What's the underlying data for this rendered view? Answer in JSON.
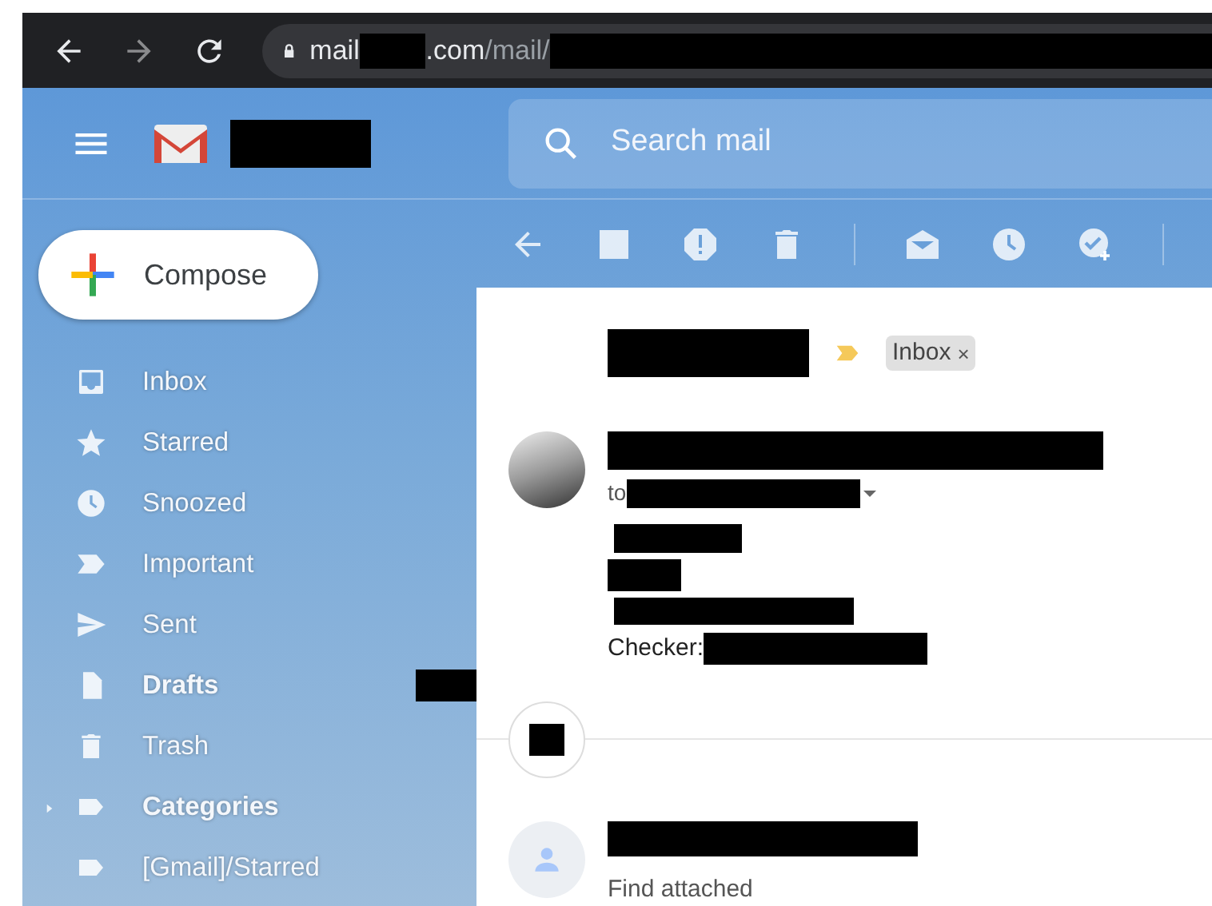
{
  "browser": {
    "url": {
      "host_start": "mail",
      "host_end": ".com",
      "path": "/mail/"
    }
  },
  "header": {
    "search": {
      "placeholder": "Search mail"
    }
  },
  "compose": {
    "label": "Compose"
  },
  "sidebar": {
    "items": [
      {
        "label": "Inbox",
        "kind": "inbox",
        "unread": false,
        "expandable": false
      },
      {
        "label": "Starred",
        "kind": "star",
        "unread": false,
        "expandable": false
      },
      {
        "label": "Snoozed",
        "kind": "clock",
        "unread": false,
        "expandable": false
      },
      {
        "label": "Important",
        "kind": "important",
        "unread": false,
        "expandable": false
      },
      {
        "label": "Sent",
        "kind": "send",
        "unread": false,
        "expandable": false
      },
      {
        "label": "Drafts",
        "kind": "file",
        "unread": true,
        "expandable": false
      },
      {
        "label": "Trash",
        "kind": "trash",
        "unread": false,
        "expandable": false
      },
      {
        "label": "Categories",
        "kind": "label",
        "unread": true,
        "expandable": true
      },
      {
        "label": "[Gmail]/Starred",
        "kind": "label",
        "unread": false,
        "expandable": false
      }
    ]
  },
  "message": {
    "labels": [
      {
        "text": "Inbox",
        "removable": true,
        "remove_symbol": "×"
      }
    ],
    "to_label": "to",
    "body_label": "Checker:",
    "reply_snippet": "Find attached"
  }
}
